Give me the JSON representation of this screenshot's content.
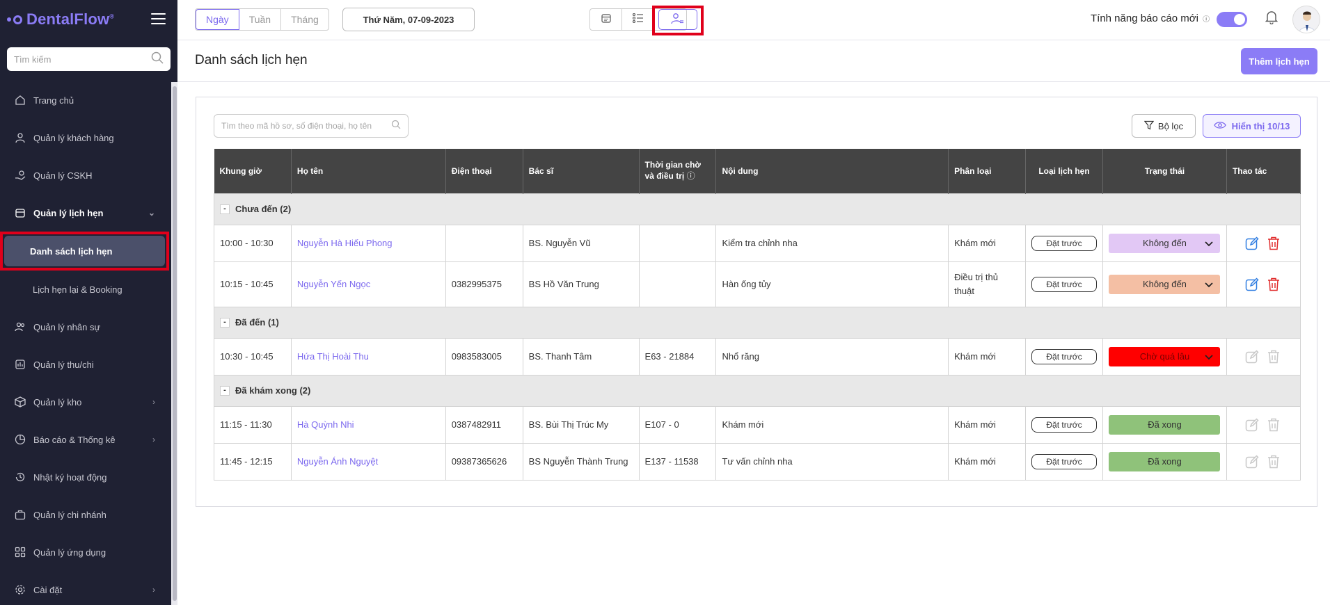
{
  "app": {
    "logo": "DentalFlow",
    "logo_mark": "®"
  },
  "sidebar": {
    "search_placeholder": "Tìm kiếm",
    "items": [
      {
        "label": "Trang chủ"
      },
      {
        "label": "Quản lý khách hàng"
      },
      {
        "label": "Quản lý CSKH"
      },
      {
        "label": "Quản lý lịch hẹn"
      },
      {
        "label": "Quản lý nhân sự"
      },
      {
        "label": "Quản lý thu/chi"
      },
      {
        "label": "Quản lý kho"
      },
      {
        "label": "Báo cáo & Thống kê"
      },
      {
        "label": "Nhật ký hoạt động"
      },
      {
        "label": "Quản lý chi nhánh"
      },
      {
        "label": "Quản lý ứng dụng"
      },
      {
        "label": "Cài đặt"
      }
    ],
    "submenu": [
      {
        "label": "Danh sách lịch hẹn"
      },
      {
        "label": "Lịch hẹn lại & Booking"
      }
    ]
  },
  "topbar": {
    "view_tabs": [
      "Ngày",
      "Tuần",
      "Tháng"
    ],
    "date": "Thứ Năm, 07-09-2023",
    "report_label": "Tính năng báo cáo mới",
    "report_info": "ⓘ"
  },
  "page": {
    "title": "Danh sách lịch hẹn",
    "add_button": "Thêm lịch hẹn"
  },
  "table_tools": {
    "search_placeholder": "Tìm theo mã hồ sơ, số điện thoại, họ tên",
    "filter_label": "Bộ lọc",
    "display_label": "Hiển thị 10/13"
  },
  "table": {
    "headers": [
      "Khung giờ",
      "Họ tên",
      "Điện thoại",
      "Bác sĩ",
      "Thời gian chờ",
      "và điều trị",
      "Nội dung",
      "Phân loại",
      "Loại lịch hẹn",
      "Trạng thái",
      "Thao tác"
    ],
    "groups": [
      {
        "label": "Chưa đến (2)",
        "rows": [
          {
            "time": "10:00 - 10:30",
            "name": "Nguyễn Hà Hiếu Phong",
            "phone": "",
            "doctor": "BS. Nguyễn Vũ",
            "wait": "",
            "content": "Kiểm tra chỉnh nha",
            "category": "Khám mới",
            "type": "Đặt trước",
            "status": "Không đến"
          },
          {
            "time": "10:15 - 10:45",
            "name": "Nguyễn Yến Ngọc",
            "phone": "0382995375",
            "doctor": "BS Hồ Văn Trung",
            "wait": "",
            "content": "Hàn ống tủy",
            "category": "Điều trị thủ thuật",
            "type": "Đặt trước",
            "status": "Không đến"
          }
        ]
      },
      {
        "label": "Đã đến (1)",
        "rows": [
          {
            "time": "10:30 - 10:45",
            "name": "Hứa Thị Hoài Thu",
            "phone": "0983583005",
            "doctor": "BS. Thanh Tâm",
            "wait": "E63 - 21884",
            "content": "Nhổ răng",
            "category": "Khám mới",
            "type": "Đặt trước",
            "status": "Chờ quá lâu"
          }
        ]
      },
      {
        "label": "Đã khám xong (2)",
        "rows": [
          {
            "time": "11:15 - 11:30",
            "name": "Hà Quỳnh Nhi",
            "phone": "0387482911",
            "doctor": "BS. Bùi Thị Trúc My",
            "wait": "E107 - 0",
            "content": "Khám mới",
            "category": "Khám mới",
            "type": "Đặt trước",
            "status": "Đã xong"
          },
          {
            "time": "11:45 - 12:15",
            "name": "Nguyễn Ánh Nguyệt",
            "phone": "09387365626",
            "doctor": "BS Nguyễn Thành Trung",
            "wait": "E137 - 11538",
            "content": "Tư vấn chỉnh nha",
            "category": "Khám mới",
            "type": "Đặt trước",
            "status": "Đã xong"
          }
        ]
      }
    ]
  },
  "colors": {
    "accent": "#8b7cf6",
    "sidebar_bg": "#1f2133",
    "status_not_arrived_1": "#e2c8f5",
    "status_not_arrived_2": "#f4bfa4",
    "status_waiting": "#ff0000",
    "status_done": "#8fc27a",
    "highlight": "#e0001b"
  }
}
